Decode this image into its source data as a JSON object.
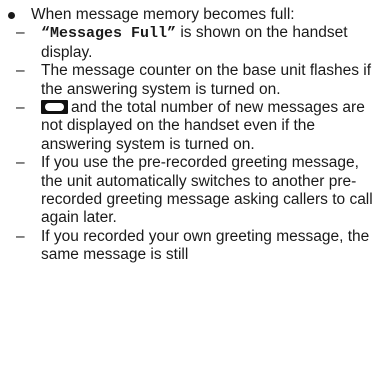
{
  "intro": "When message memory becomes full:",
  "items": [
    {
      "quoted": "“Messages Full”",
      "text": " is shown on the handset display."
    },
    {
      "text": "The message counter on the base unit flashes if the answering system is turned on."
    },
    {
      "icon": "answering-machine-tape-icon",
      "text": "and the total number of new messages are not displayed on the handset even if the answering system is turned on."
    },
    {
      "text": "If you use the pre-recorded greeting message, the unit automatically switches to another pre-recorded greeting message asking callers to call again later."
    },
    {
      "text": "If you recorded your own greeting message, the same message is still"
    }
  ],
  "dash": "–"
}
